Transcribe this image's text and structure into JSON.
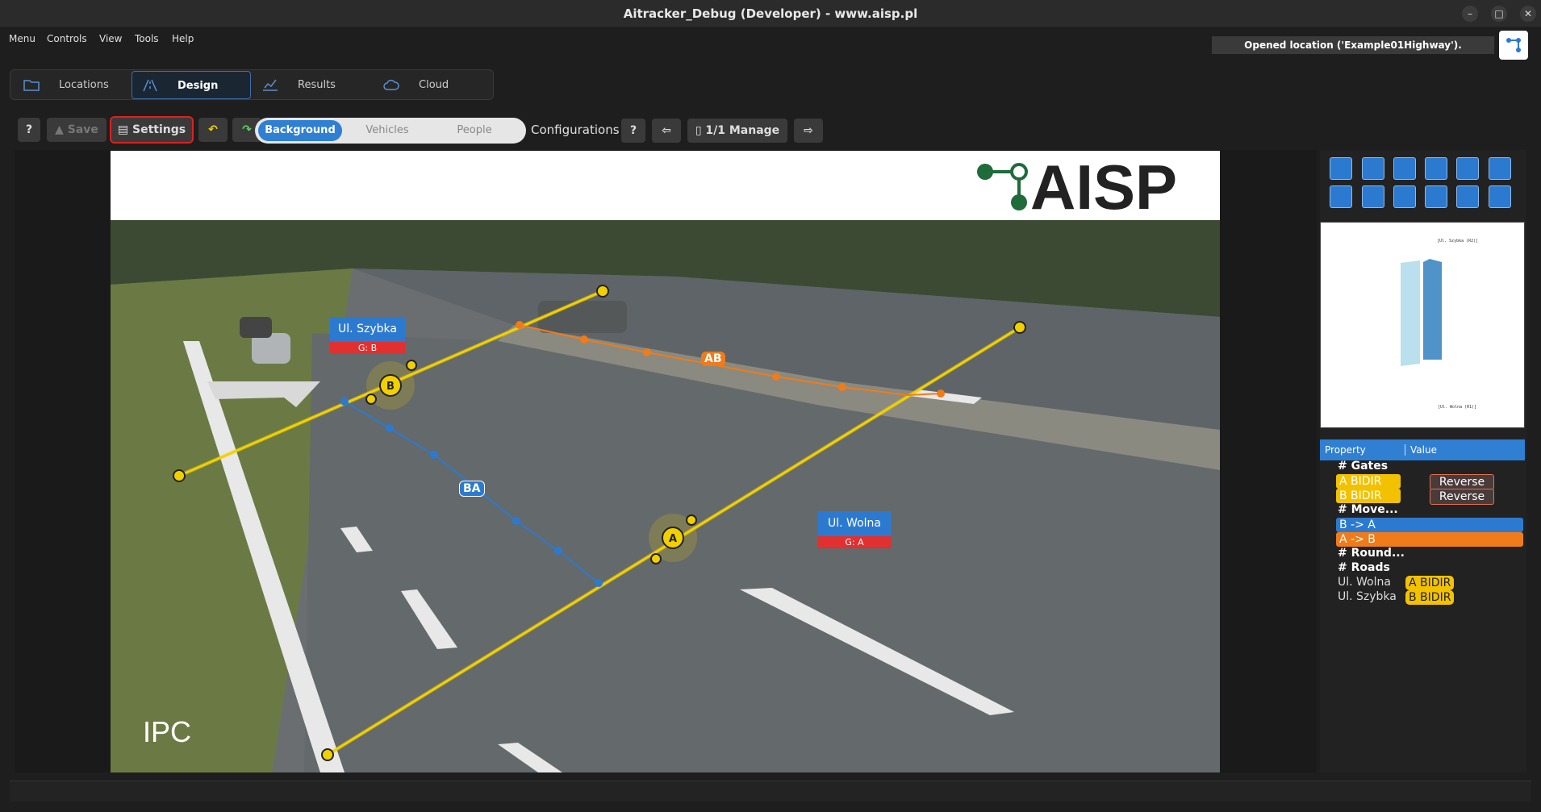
{
  "window": {
    "title": "Aitracker_Debug (Developer) - www.aisp.pl",
    "controls": [
      "–",
      "□",
      "✕"
    ]
  },
  "menu": [
    "Menu",
    "Controls",
    "View",
    "Tools",
    "Help"
  ],
  "status": "Opened location ('Example01Highway').",
  "tabs": [
    {
      "label": "Locations",
      "icon": "folder-icon"
    },
    {
      "label": "Design",
      "icon": "road-icon"
    },
    {
      "label": "Results",
      "icon": "chart-icon"
    },
    {
      "label": "Cloud",
      "icon": "cloud-icon"
    }
  ],
  "toolbar": {
    "help": "?",
    "save": "Save",
    "settings": "Settings",
    "undo": "↶",
    "redo": "↷",
    "modes": [
      "Background",
      "Vehicles",
      "People"
    ],
    "configurations_label": "Configurations :",
    "conf_help": "?",
    "prev": "⇦",
    "manage": "1/1 Manage",
    "next": "⇨"
  },
  "scene": {
    "brand": "AISP",
    "watermark": "IPC",
    "roads": [
      {
        "name": "Ul. Szybka",
        "gate": "G: B"
      },
      {
        "name": "Ul. Wolna",
        "gate": "G: A"
      }
    ],
    "gates": [
      "A",
      "B"
    ],
    "movements": [
      "AB",
      "BA"
    ]
  },
  "preview": {
    "top_label": "[Ul. Szybka (R2)]",
    "bottom_label": "[Ul. Wolna (R1)]"
  },
  "properties": {
    "headers": [
      "Property",
      "Value"
    ],
    "gates_section": "# Gates",
    "gates": [
      {
        "name": "A BIDIR",
        "action": "Reverse"
      },
      {
        "name": "B BIDIR",
        "action": "Reverse"
      }
    ],
    "moves_section": "# Move...",
    "moves": [
      "B -> A",
      "A -> B"
    ],
    "round_section": "# Round...",
    "roads_section": "# Roads",
    "roads": [
      {
        "name": "Ul. Wolna",
        "gate": "A BIDIR"
      },
      {
        "name": "Ul. Szybka",
        "gate": "B BIDIR"
      }
    ]
  },
  "colors": {
    "accent": "#2f7fd3",
    "gate": "#f2d000",
    "move_ab": "#f07b1a",
    "move_ba": "#2c7ad0",
    "road_gate": "#e03030"
  }
}
